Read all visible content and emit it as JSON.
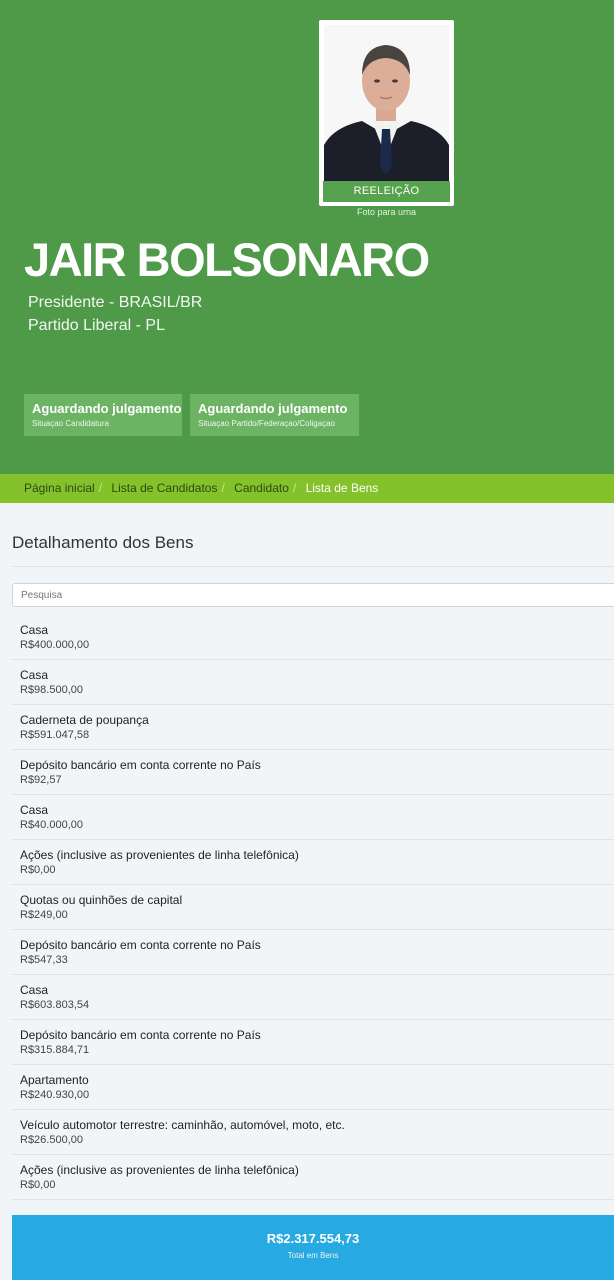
{
  "candidate": {
    "photo_badge": "REELEIÇÃO",
    "photo_caption": "Foto para urna",
    "name": "JAIR BOLSONARO",
    "role": "Presidente - BRASIL/BR",
    "party": "Partido Liberal - PL"
  },
  "status": [
    {
      "title": "Aguardando julgamento",
      "subtitle": "Situaçao Candidatura"
    },
    {
      "title": "Aguardando julgamento",
      "subtitle": "Situaçao Partido/Federaçao/Coligaçao"
    }
  ],
  "breadcrumb": [
    "Página inicial",
    "Lista de Candidatos",
    "Candidato",
    "Lista de Bens"
  ],
  "section_title": "Detalhamento dos Bens",
  "search": {
    "placeholder": "Pesquisa"
  },
  "assets": [
    {
      "label": "Casa",
      "value": "R$400.000,00"
    },
    {
      "label": "Casa",
      "value": "R$98.500,00"
    },
    {
      "label": "Caderneta de poupança",
      "value": "R$591.047,58"
    },
    {
      "label": "Depósito bancário em conta corrente no País",
      "value": "R$92,57"
    },
    {
      "label": "Casa",
      "value": "R$40.000,00"
    },
    {
      "label": "Ações (inclusive as provenientes de linha telefônica)",
      "value": "R$0,00"
    },
    {
      "label": "Quotas ou quinhões de capital",
      "value": "R$249,00"
    },
    {
      "label": "Depósito bancário em conta corrente no País",
      "value": "R$547,33"
    },
    {
      "label": "Casa",
      "value": "R$603.803,54"
    },
    {
      "label": "Depósito bancário em conta corrente no País",
      "value": "R$315.884,71"
    },
    {
      "label": "Apartamento",
      "value": "R$240.930,00"
    },
    {
      "label": "Veículo automotor terrestre: caminhão, automóvel, moto, etc.",
      "value": "R$26.500,00"
    },
    {
      "label": "Ações (inclusive as provenientes de linha telefônica)",
      "value": "R$0,00"
    }
  ],
  "total": {
    "amount": "R$2.317.554,73",
    "label": "Total em Bens"
  },
  "colors": {
    "hero": "#4f9a49",
    "breadcrumb_bar": "#83c22a",
    "total_bar": "#27a9e1",
    "badge": "#6cb364"
  }
}
